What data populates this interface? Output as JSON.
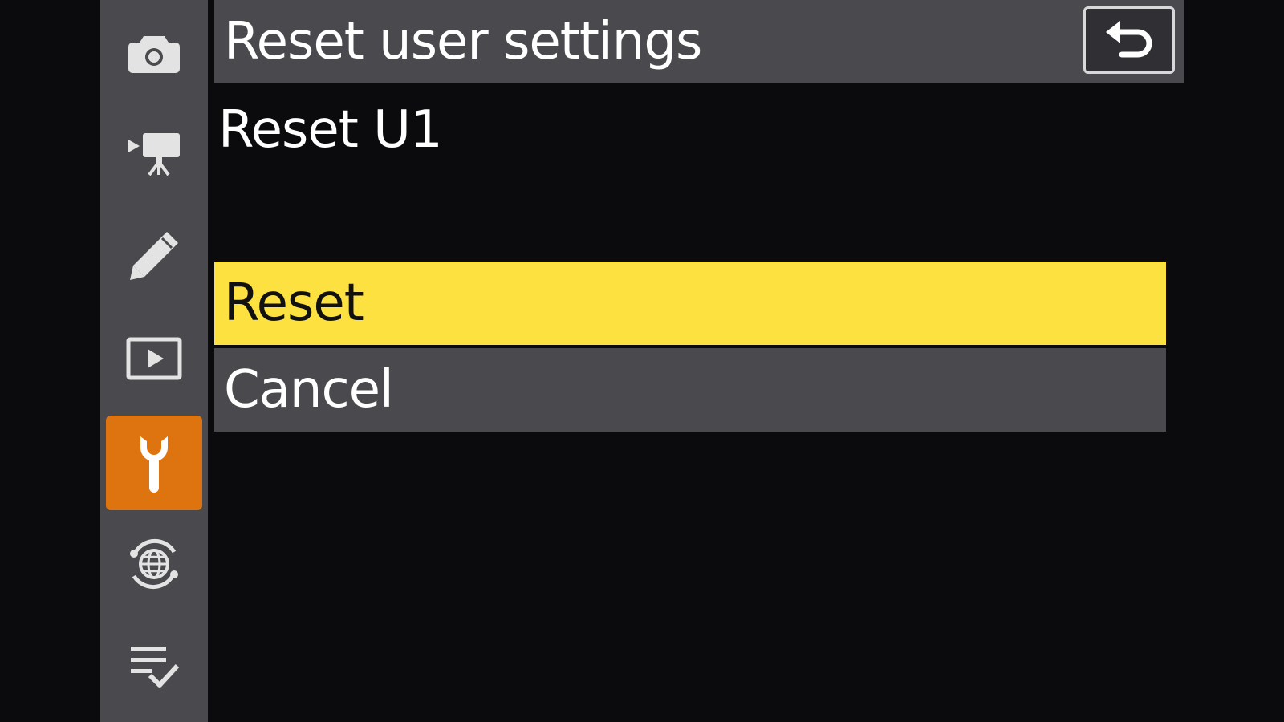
{
  "menu": {
    "title": "Reset user settings",
    "subtitle": "Reset U1",
    "options": [
      {
        "label": "Reset",
        "selected": true
      },
      {
        "label": "Cancel",
        "selected": false
      }
    ]
  },
  "tabs": [
    {
      "icon": "camera-icon",
      "active": false
    },
    {
      "icon": "movie-camera-icon",
      "active": false
    },
    {
      "icon": "pencil-icon",
      "active": false
    },
    {
      "icon": "playback-icon",
      "active": false
    },
    {
      "icon": "wrench-icon",
      "active": true
    },
    {
      "icon": "network-globe-icon",
      "active": false
    },
    {
      "icon": "my-menu-checklist-icon",
      "active": false
    }
  ],
  "back_button": {
    "icon": "return-arrow-icon"
  },
  "colors": {
    "background": "#0b0a0d",
    "rail": "#4a494d",
    "active_tab": "#de740f",
    "selected_option": "#fde141",
    "icon": "#e3e3e3"
  }
}
